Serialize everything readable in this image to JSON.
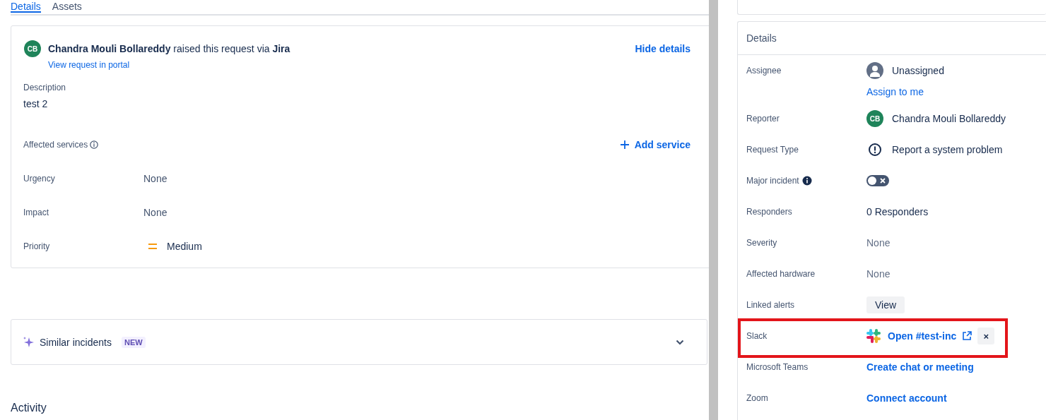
{
  "tabs": [
    {
      "label": "Details",
      "selected": true
    },
    {
      "label": "Assets",
      "selected": false
    }
  ],
  "request": {
    "avatar_initials": "CB",
    "reporter": "Chandra Mouli Bollareddy",
    "via_text": "raised this request via",
    "channel": "Jira",
    "portal_link": "View request in portal",
    "hide_link": "Hide details"
  },
  "description": {
    "label": "Description",
    "value": "test 2"
  },
  "affected_services": {
    "label": "Affected services",
    "action": "Add service"
  },
  "fields": [
    {
      "label": "Urgency",
      "value": "None",
      "kind": "empty"
    },
    {
      "label": "Impact",
      "value": "None",
      "kind": "empty"
    },
    {
      "label": "Priority",
      "value": "Medium",
      "kind": "priority"
    }
  ],
  "similar_incidents": {
    "title": "Similar incidents",
    "badge": "NEW",
    "expanded": false
  },
  "activity": {
    "title": "Activity"
  },
  "details": {
    "title": "Details",
    "rows": [
      {
        "label": "Assignee",
        "kind": "assignee",
        "value": "Unassigned",
        "link": "Assign to me"
      },
      {
        "label": "Reporter",
        "kind": "person",
        "initials": "CB",
        "value": "Chandra Mouli Bollareddy"
      },
      {
        "label": "Request Type",
        "kind": "request-type",
        "value": "Report a system problem"
      },
      {
        "label": "Major incident",
        "kind": "toggle",
        "on": false
      },
      {
        "label": "Responders",
        "kind": "text",
        "value": "0 Responders"
      },
      {
        "label": "Severity",
        "kind": "empty",
        "value": "None"
      },
      {
        "label": "Affected hardware",
        "kind": "empty",
        "value": "None"
      },
      {
        "label": "Linked alerts",
        "kind": "button",
        "value": "View"
      },
      {
        "label": "Slack",
        "kind": "slack",
        "value": "Open #test-inc",
        "remove": "×",
        "highlighted": true
      },
      {
        "label": "Microsoft Teams",
        "kind": "link",
        "value": "Create chat or meeting"
      },
      {
        "label": "Zoom",
        "kind": "link",
        "value": "Connect account"
      }
    ]
  }
}
